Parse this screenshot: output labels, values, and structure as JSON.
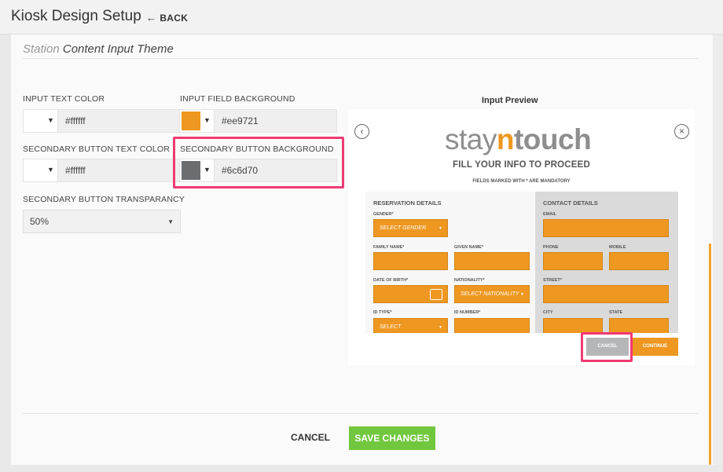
{
  "header": {
    "title": "Kiosk Design Setup",
    "back_label": "BACK",
    "back_arrow": "←"
  },
  "section": {
    "title_muted": "Station",
    "title_main": "Content Input Theme"
  },
  "fields": {
    "input_text_color": {
      "label": "INPUT TEXT COLOR",
      "value": "#ffffff",
      "swatch": "#ffffff"
    },
    "input_field_background": {
      "label": "INPUT FIELD BACKGROUND",
      "value": "#ee9721",
      "swatch": "#ee9721"
    },
    "secondary_button_text_color": {
      "label": "SECONDARY BUTTON TEXT COLOR",
      "value": "#ffffff",
      "swatch": "#ffffff"
    },
    "secondary_button_background": {
      "label": "SECONDARY BUTTON BACKGROUND",
      "value": "#6c6d70",
      "swatch": "#6c6d70"
    },
    "secondary_button_transparency": {
      "label": "SECONDARY BUTTON TRANSPARANCY",
      "value": "50%"
    }
  },
  "preview": {
    "title": "Input Preview",
    "logo_part1": "stay",
    "logo_part2": "n",
    "logo_part3": "touch",
    "heading": "FILL YOUR INFO TO PROCEED",
    "mandatory_note": "FIELDS MARKED WITH * ARE MANDATORY",
    "reservation_title": "RESERVATION DETAILS",
    "contact_title": "CONTACT DETAILS",
    "labels": {
      "gender": "GENDER*",
      "family_name": "FAMILY NAME*",
      "given_name": "GIVEN NAME*",
      "date_of_birth": "DATE OF BIRTH*",
      "nationality": "NATIONALITY*",
      "id_type": "ID TYPE*",
      "id_number": "ID NUMBER*",
      "email": "EMAIL",
      "phone": "PHONE",
      "mobile": "MOBILE",
      "street": "STREET*",
      "city": "CITY",
      "state": "STATE"
    },
    "placeholders": {
      "gender": "SELECT GENDER",
      "nationality": "SELECT NATIONALITY",
      "id_type": "SELECT"
    },
    "cancel_label": "CANCEL",
    "continue_label": "CONTINUE",
    "nav_left_icon": "‹",
    "nav_right_icon": "×"
  },
  "footer": {
    "cancel_label": "CANCEL",
    "save_label": "SAVE CHANGES"
  },
  "colors": {
    "accent": "#ee9721",
    "highlight": "#ef3a73",
    "save_green": "#71c73d",
    "secondary_button": "#6c6d70"
  }
}
